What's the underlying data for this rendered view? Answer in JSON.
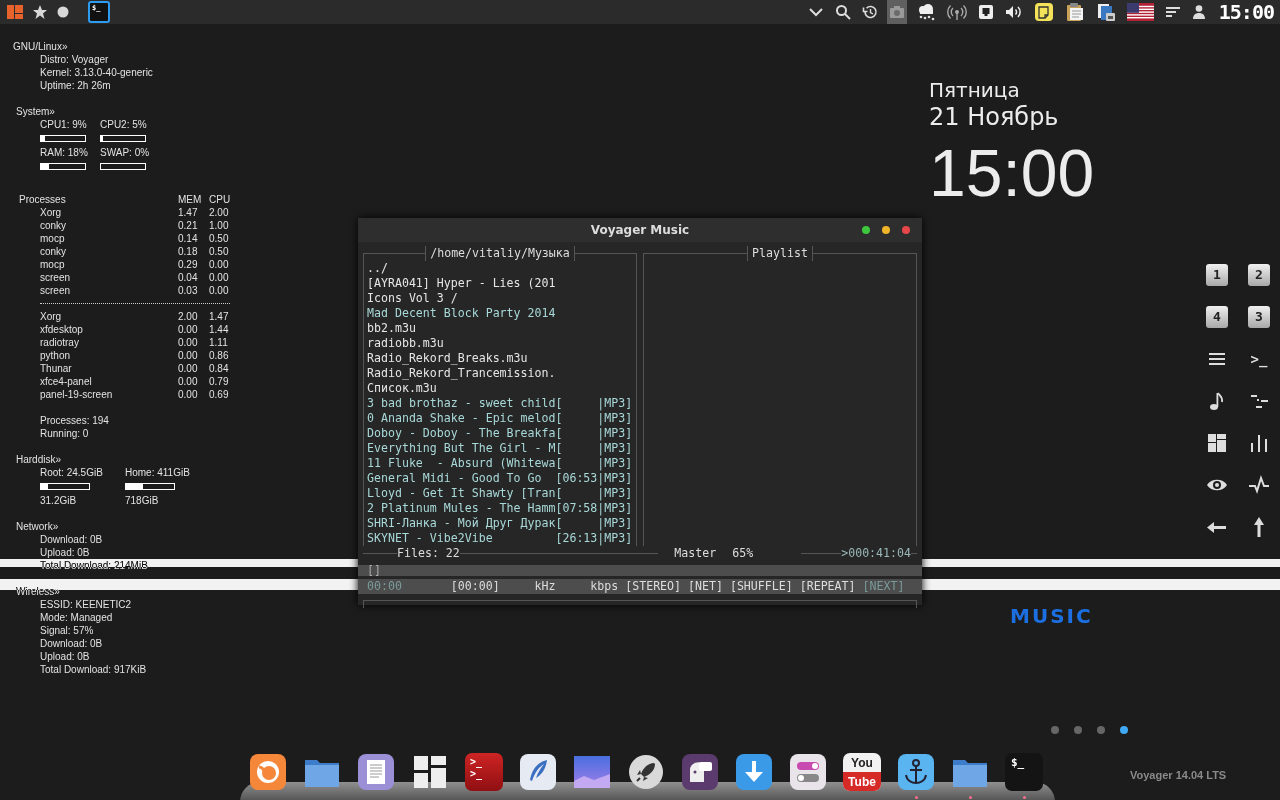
{
  "top_panel": {
    "launchers": [
      {
        "kind": "apps",
        "selected": false
      },
      {
        "kind": "star",
        "selected": false
      },
      {
        "kind": "circle",
        "selected": false
      },
      {
        "kind": "terminal",
        "glyph": "$_",
        "selected": true
      }
    ],
    "tray": [
      {
        "kind": "chevron",
        "highlighted": false
      },
      {
        "kind": "search",
        "highlighted": false
      },
      {
        "kind": "history",
        "highlighted": false
      },
      {
        "kind": "camera",
        "highlighted": true
      },
      {
        "kind": "weather",
        "highlighted": false
      },
      {
        "kind": "wireless",
        "highlighted": false
      },
      {
        "kind": "network",
        "highlighted": false
      },
      {
        "kind": "volume",
        "highlighted": false
      },
      {
        "kind": "notes",
        "highlighted": false
      },
      {
        "kind": "clipboard",
        "highlighted": false
      },
      {
        "kind": "battery",
        "highlighted": false
      },
      {
        "kind": "flag",
        "highlighted": false
      },
      {
        "kind": "menu",
        "highlighted": false
      },
      {
        "kind": "user",
        "highlighted": false
      }
    ],
    "clock": "15:00"
  },
  "conky": {
    "linux": {
      "heading": "GNU/Linux»",
      "lines": [
        "Distro: Voyager",
        "Kernel: 3.13.0-40-generic",
        "Uptime: 2h 26m"
      ]
    },
    "system": {
      "heading": "System»",
      "meters": [
        {
          "label": "CPU1: 9%",
          "level": 0.09
        },
        {
          "label": "CPU2: 5%",
          "level": 0.05
        },
        {
          "label": "RAM: 18%",
          "level": 0.18
        },
        {
          "label": "SWAP: 0%",
          "level": 0
        }
      ]
    },
    "processes": {
      "heading": "Processes",
      "columns": [
        "MEM",
        "CPU"
      ],
      "groups": [
        [
          {
            "name": "Xorg",
            "mem": "1.47",
            "cpu": "2.00"
          },
          {
            "name": "conky",
            "mem": "0.21",
            "cpu": "1.00"
          },
          {
            "name": "mocp",
            "mem": "0.14",
            "cpu": "0.50"
          },
          {
            "name": "conky",
            "mem": "0.18",
            "cpu": "0.50"
          },
          {
            "name": "mocp",
            "mem": "0.29",
            "cpu": "0.00"
          },
          {
            "name": "screen",
            "mem": "0.04",
            "cpu": "0.00"
          },
          {
            "name": "screen",
            "mem": "0.03",
            "cpu": "0.00"
          }
        ],
        [
          {
            "name": "Xorg",
            "mem": "2.00",
            "cpu": "1.47"
          },
          {
            "name": "xfdesktop",
            "mem": "0.00",
            "cpu": "1.44"
          },
          {
            "name": "radiotray",
            "mem": "0.00",
            "cpu": "1.11"
          },
          {
            "name": "python",
            "mem": "0.00",
            "cpu": "0.86"
          },
          {
            "name": "Thunar",
            "mem": "0.00",
            "cpu": "0.84"
          },
          {
            "name": "xfce4-panel",
            "mem": "0.00",
            "cpu": "0.79"
          },
          {
            "name": "panel-19-screen",
            "mem": "0.00",
            "cpu": "0.69"
          }
        ]
      ],
      "totals": [
        "Processes: 194",
        "Running: 0"
      ]
    },
    "harddisk": {
      "heading": "Harddisk»",
      "disks": [
        {
          "label": "Root: 24.5GiB",
          "level": 0.15,
          "size": "31.2GiB"
        },
        {
          "label": "Home: 411GiB",
          "level": 0.35,
          "size": "718GiB"
        }
      ]
    },
    "network": {
      "heading": "Network»",
      "lines": [
        "Download: 0B",
        "Upload: 0B",
        "Total Download: 214MiB"
      ]
    },
    "wireless": {
      "heading": "Wireless»",
      "lines": [
        "ESSID: KEENETIC2",
        "Mode: Managed",
        "Signal: 57%",
        "Download: 0B",
        "Upload: 0B",
        "Total Download: 917KiB"
      ]
    }
  },
  "date_widget": {
    "weekday": "Пятница",
    "date": "21 Ноябрь",
    "time": "15:00"
  },
  "music_window": {
    "title": "Voyager Music",
    "window_buttons": [
      {
        "color": "#3ec73e"
      },
      {
        "color": "#f0b429"
      },
      {
        "color": "#e8474a"
      }
    ],
    "browser": {
      "title": "/home/vitaliy/Музыка",
      "items": [
        {
          "name": "../",
          "color": "#e6e6e6"
        },
        {
          "name": "[AYRA041] Hyper - Lies (201",
          "color": "#e6e6e6"
        },
        {
          "name": "Icons Vol 3 /",
          "color": "#e6e6e6"
        },
        {
          "name": "Mad Decent Block Party 2014",
          "color": "#a8d8d8"
        },
        {
          "name": "bb2.m3u",
          "color": "#e6e6e6"
        },
        {
          "name": "radiobb.m3u",
          "color": "#e6e6e6"
        },
        {
          "name": "Radio_Rekord_Breaks.m3u",
          "color": "#e6e6e6"
        },
        {
          "name": "Radio_Rekord_Trancemission.",
          "color": "#e6e6e6"
        },
        {
          "name": "Список.m3u",
          "color": "#e6e6e6"
        },
        {
          "name": "3 bad brothaz - sweet child",
          "time": "[",
          "format": "|MP3]",
          "color": "#a8d8d8"
        },
        {
          "name": "0 Ananda Shake - Epic melod",
          "time": "[",
          "format": "|MP3]",
          "color": "#a8d8d8"
        },
        {
          "name": "Doboy - Doboy - The Breakfa",
          "time": "[",
          "format": "|MP3]",
          "color": "#a8d8d8"
        },
        {
          "name": "Everything But The Girl - M",
          "time": "[",
          "format": "|MP3]",
          "color": "#a8d8d8"
        },
        {
          "name": "11 Fluke  - Absurd (Whitewa",
          "time": "[",
          "format": "|MP3]",
          "color": "#a8d8d8"
        },
        {
          "name": "General Midi - Good To Go",
          "time": "[06:53",
          "format": "|MP3]",
          "color": "#a8d8d8"
        },
        {
          "name": "Lloyd - Get It Shawty [Tran",
          "time": "[",
          "format": "|MP3]",
          "color": "#a8d8d8"
        },
        {
          "name": "2 Platinum Mules - The Hamm",
          "time": "[07:58",
          "format": "|MP3]",
          "color": "#a8d8d8"
        },
        {
          "name": "SHRI-Ланка - Мой Друг Дурак",
          "time": "[",
          "format": "|MP3]",
          "color": "#a8d8d8"
        },
        {
          "name": "SKYNET - Vibe2Vibe",
          "time": "[26:13",
          "format": "|MP3]",
          "color": "#a8d8d8"
        }
      ]
    },
    "playlist": {
      "title": "Playlist"
    },
    "status": {
      "files": "Files: 22",
      "mixer": "Master",
      "volume": "65%",
      "total_time": ">000:41:04"
    },
    "title_line": "[]",
    "info": {
      "elapsed": "00:00",
      "duration": "[00:00]",
      "rate": "kHz",
      "bitrate": "kbps",
      "toggles": [
        {
          "label": "[STEREO]",
          "on": true
        },
        {
          "label": "[NET]",
          "on": true
        },
        {
          "label": "[SHUFFLE]",
          "on": true
        },
        {
          "label": "[REPEAT]",
          "on": true
        },
        {
          "label": "[NEXT]",
          "on": false
        }
      ]
    }
  },
  "shortcuts": [
    {
      "kind": "key",
      "label": "1"
    },
    {
      "kind": "key",
      "label": "2"
    },
    {
      "kind": "key",
      "label": "4"
    },
    {
      "kind": "key",
      "label": "3"
    },
    {
      "kind": "menu"
    },
    {
      "kind": "terminal",
      "glyph": ">_"
    },
    {
      "kind": "note"
    },
    {
      "kind": "dashes"
    },
    {
      "kind": "tiles"
    },
    {
      "kind": "bars"
    },
    {
      "kind": "eye"
    },
    {
      "kind": "pulse"
    },
    {
      "kind": "left"
    },
    {
      "kind": "up"
    }
  ],
  "music_logo": "MUSIC",
  "pager": [
    {
      "selected": false
    },
    {
      "selected": false
    },
    {
      "selected": false
    },
    {
      "selected": true
    }
  ],
  "dock": [
    {
      "kind": "firefox",
      "running": false
    },
    {
      "kind": "folder",
      "running": false
    },
    {
      "kind": "document",
      "running": false
    },
    {
      "kind": "tiles",
      "running": false
    },
    {
      "kind": "terminal-red",
      "glyph": ">_",
      "running": false
    },
    {
      "kind": "feather",
      "running": false
    },
    {
      "kind": "wallpaper",
      "running": false
    },
    {
      "kind": "rocket",
      "running": false
    },
    {
      "kind": "chat",
      "running": false
    },
    {
      "kind": "download",
      "running": false
    },
    {
      "kind": "toggles",
      "running": false
    },
    {
      "kind": "video",
      "label_top": "You",
      "label_bottom": "Tube",
      "running": false
    },
    {
      "kind": "anchor",
      "running": true
    },
    {
      "kind": "folder",
      "running": true
    },
    {
      "kind": "terminal",
      "glyph": "$_",
      "running": true
    }
  ],
  "version": "Voyager 14.04 LTS"
}
